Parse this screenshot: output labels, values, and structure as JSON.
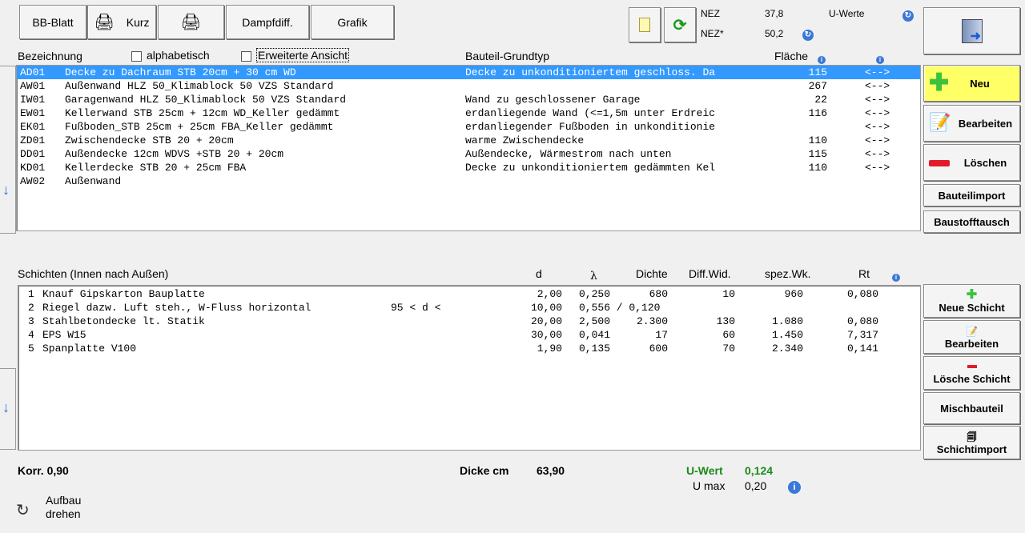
{
  "toolbar": {
    "bb_blatt": "BB-Blatt",
    "kurz": "Kurz",
    "dampfdiff": "Dampfdiff.",
    "grafik": "Grafik"
  },
  "nez": {
    "nez_label": "NEZ",
    "nez_value": "37,8",
    "nez_star_label": "NEZ*",
    "nez_star_value": "50,2",
    "u_werte_label": "U-Werte"
  },
  "bauteile": {
    "col_bezeichnung": "Bezeichnung",
    "chk_alphabetisch": "alphabetisch",
    "chk_erweitert": "Erweiterte Ansicht",
    "col_grundtyp": "Bauteil-Grundtyp",
    "col_flaeche": "Fläche",
    "rows": [
      {
        "code": "AD01",
        "name": "Decke zu Dachraum STB 20cm + 30 cm WD",
        "typ": "Decke zu unkonditioniertem geschloss. Da",
        "flaeche": "115",
        "arrow": "<-->"
      },
      {
        "code": "AW01",
        "name": "Außenwand HLZ 50_Klimablock 50 VZS Standard",
        "typ": "",
        "flaeche": "267",
        "arrow": "<-->"
      },
      {
        "code": "IW01",
        "name": "Garagenwand HLZ 50_Klimablock 50 VZS Standard",
        "typ": "Wand zu geschlossener Garage",
        "flaeche": "22",
        "arrow": "<-->"
      },
      {
        "code": "EW01",
        "name": "Kellerwand STB 25cm + 12cm WD_Keller gedämmt",
        "typ": "erdanliegende Wand (<=1,5m unter Erdreic",
        "flaeche": "116",
        "arrow": "<-->"
      },
      {
        "code": "EK01",
        "name": "Fußboden_STB 25cm + 25cm FBA_Keller gedämmt",
        "typ": "erdanliegender Fußboden in unkonditionie",
        "flaeche": "",
        "arrow": "<-->"
      },
      {
        "code": "ZD01",
        "name": "Zwischendecke STB 20 + 20cm",
        "typ": "warme Zwischendecke",
        "flaeche": "110",
        "arrow": "<-->"
      },
      {
        "code": "DD01",
        "name": "Außendecke 12cm WDVS +STB 20 + 20cm",
        "typ": "Außendecke, Wärmestrom nach unten",
        "flaeche": "115",
        "arrow": "<-->"
      },
      {
        "code": "KD01",
        "name": "Kellerdecke STB 20 + 25cm FBA",
        "typ": "Decke zu unkonditioniertem gedämmten Kel",
        "flaeche": "110",
        "arrow": "<-->"
      },
      {
        "code": "AW02",
        "name": "Außenwand",
        "typ": "",
        "flaeche": "",
        "arrow": ""
      }
    ]
  },
  "schichten": {
    "title": "Schichten (Innen nach Außen)",
    "col_d": "d",
    "col_lambda": "λ",
    "col_dichte": "Dichte",
    "col_diff": "Diff.Wid.",
    "col_spez": "spez.Wk.",
    "col_rt": "Rt",
    "rows": [
      {
        "nr": "1",
        "name": "Knauf Gipskarton Bauplatte",
        "extra": "",
        "d": "2,00",
        "lambda": "0,250",
        "dichte": "680",
        "diff": "10",
        "spez": "960",
        "rt": "0,080"
      },
      {
        "nr": "2",
        "name": "Riegel dazw. Luft steh., W-Fluss horizontal",
        "extra": "95 < d <",
        "d": "10,00",
        "lambda": "0,556 / 0,120",
        "dichte": "",
        "diff": "",
        "spez": "",
        "rt": ""
      },
      {
        "nr": "3",
        "name": "Stahlbetondecke lt. Statik",
        "extra": "",
        "d": "20,00",
        "lambda": "2,500",
        "dichte": "2.300",
        "diff": "130",
        "spez": "1.080",
        "rt": "0,080"
      },
      {
        "nr": "4",
        "name": "EPS W15",
        "extra": "",
        "d": "30,00",
        "lambda": "0,041",
        "dichte": "17",
        "diff": "60",
        "spez": "1.450",
        "rt": "7,317"
      },
      {
        "nr": "5",
        "name": "Spanplatte V100",
        "extra": "",
        "d": "1,90",
        "lambda": "0,135",
        "dichte": "600",
        "diff": "70",
        "spez": "2.340",
        "rt": "0,141"
      }
    ]
  },
  "footer": {
    "korr": "Korr. 0,90",
    "dicke_label": "Dicke cm",
    "dicke_value": "63,90",
    "uwert_label": "U-Wert",
    "uwert_value": "0,124",
    "umax_label": "U max",
    "umax_value": "0,20",
    "aufbau": "Aufbau",
    "drehen": "drehen"
  },
  "sidebar": {
    "neu": "Neu",
    "bearbeiten": "Bearbeiten",
    "loeschen": "Löschen",
    "bauteilimport": "Bauteilimport",
    "baustofftausch": "Baustofftausch",
    "neue_schicht": "Neue Schicht",
    "bearbeiten2": "Bearbeiten",
    "loesche_schicht": "Lösche Schicht",
    "mischbauteil": "Mischbauteil",
    "schichtimport": "Schichtimport"
  },
  "colors": {
    "selection": "#3399ff",
    "neu_bg": "#ffff66",
    "uwert_green": "#1a8a1a"
  }
}
